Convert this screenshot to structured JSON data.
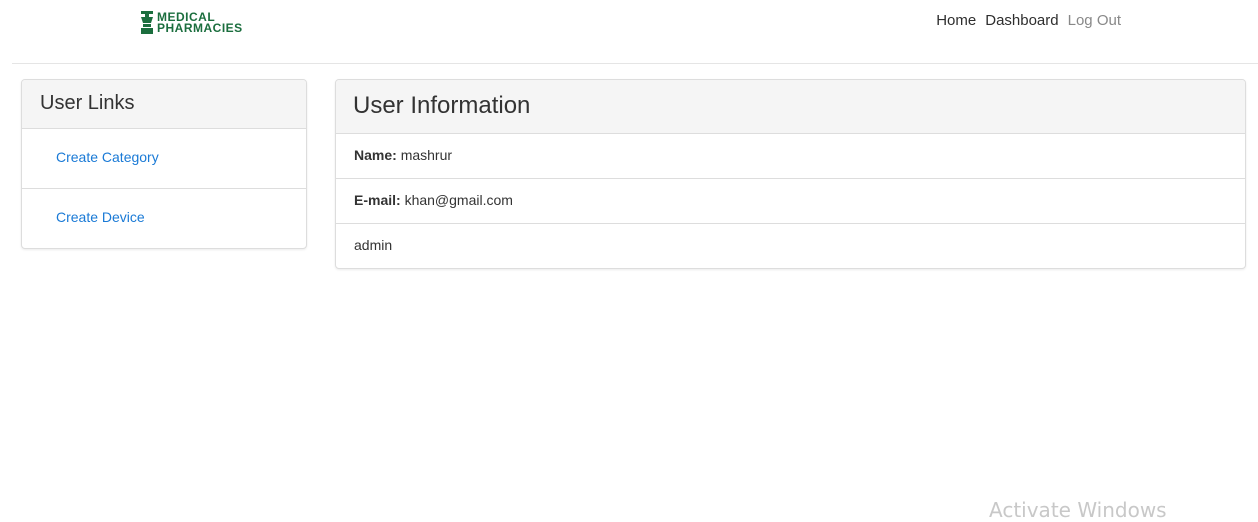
{
  "brand": {
    "line1": "Medical",
    "line2": "Pharmacies",
    "color": "#1b6e3e",
    "icon": "mortar-pestle-icon"
  },
  "nav": {
    "home": "Home",
    "dashboard": "Dashboard",
    "logout": "Log Out"
  },
  "sidebar": {
    "title": "User Links",
    "links": [
      {
        "label": "Create Category"
      },
      {
        "label": "Create Device"
      }
    ],
    "link_color": "#1a7ad6"
  },
  "user_info": {
    "title": "User Information",
    "name_label": "Name:",
    "name_value": "mashrur",
    "email_label": "E-mail:",
    "email_value": "khan@gmail.com",
    "role": "admin"
  },
  "watermark": "Activate Windows"
}
